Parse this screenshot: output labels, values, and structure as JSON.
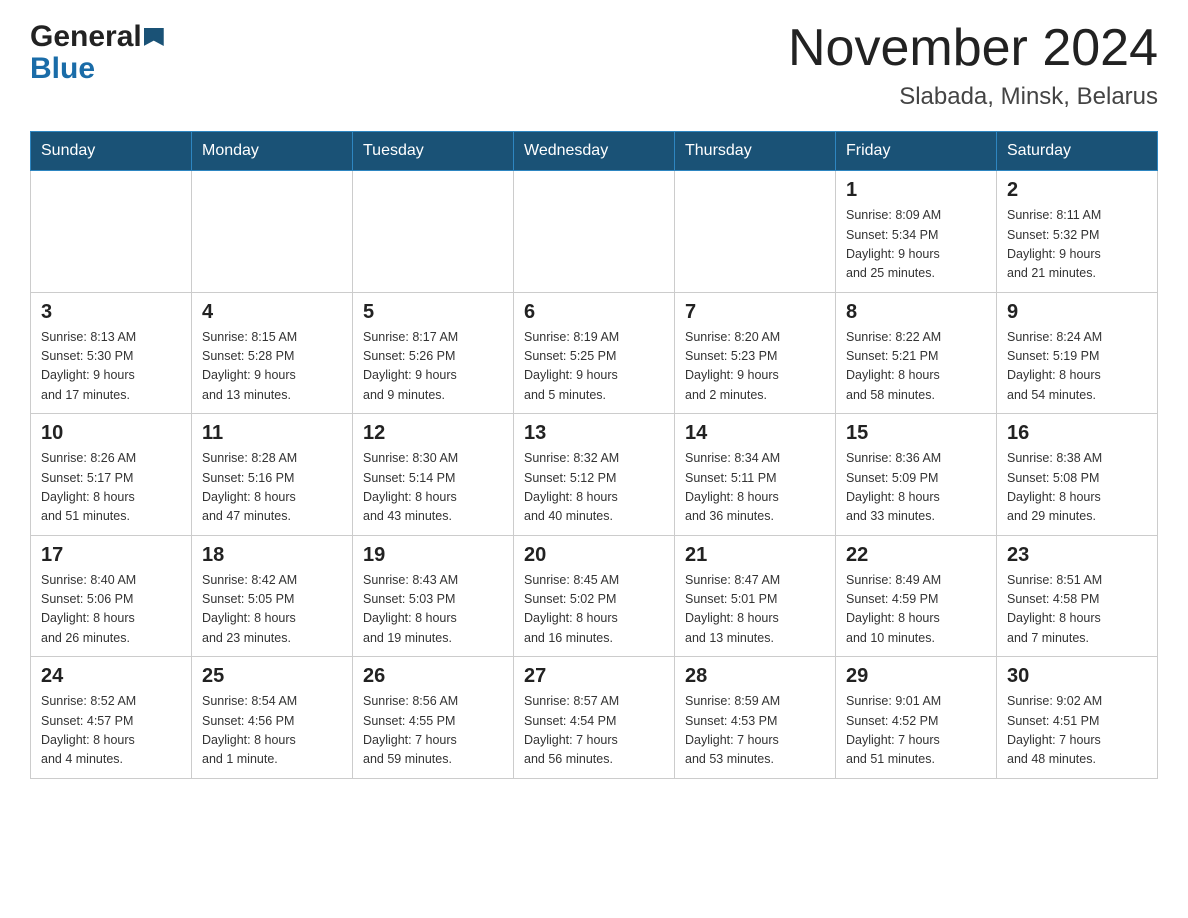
{
  "header": {
    "logo_general": "General",
    "logo_blue": "Blue",
    "month_title": "November 2024",
    "location": "Slabada, Minsk, Belarus"
  },
  "weekdays": [
    "Sunday",
    "Monday",
    "Tuesday",
    "Wednesday",
    "Thursday",
    "Friday",
    "Saturday"
  ],
  "weeks": [
    [
      {
        "day": "",
        "info": ""
      },
      {
        "day": "",
        "info": ""
      },
      {
        "day": "",
        "info": ""
      },
      {
        "day": "",
        "info": ""
      },
      {
        "day": "",
        "info": ""
      },
      {
        "day": "1",
        "info": "Sunrise: 8:09 AM\nSunset: 5:34 PM\nDaylight: 9 hours\nand 25 minutes."
      },
      {
        "day": "2",
        "info": "Sunrise: 8:11 AM\nSunset: 5:32 PM\nDaylight: 9 hours\nand 21 minutes."
      }
    ],
    [
      {
        "day": "3",
        "info": "Sunrise: 8:13 AM\nSunset: 5:30 PM\nDaylight: 9 hours\nand 17 minutes."
      },
      {
        "day": "4",
        "info": "Sunrise: 8:15 AM\nSunset: 5:28 PM\nDaylight: 9 hours\nand 13 minutes."
      },
      {
        "day": "5",
        "info": "Sunrise: 8:17 AM\nSunset: 5:26 PM\nDaylight: 9 hours\nand 9 minutes."
      },
      {
        "day": "6",
        "info": "Sunrise: 8:19 AM\nSunset: 5:25 PM\nDaylight: 9 hours\nand 5 minutes."
      },
      {
        "day": "7",
        "info": "Sunrise: 8:20 AM\nSunset: 5:23 PM\nDaylight: 9 hours\nand 2 minutes."
      },
      {
        "day": "8",
        "info": "Sunrise: 8:22 AM\nSunset: 5:21 PM\nDaylight: 8 hours\nand 58 minutes."
      },
      {
        "day": "9",
        "info": "Sunrise: 8:24 AM\nSunset: 5:19 PM\nDaylight: 8 hours\nand 54 minutes."
      }
    ],
    [
      {
        "day": "10",
        "info": "Sunrise: 8:26 AM\nSunset: 5:17 PM\nDaylight: 8 hours\nand 51 minutes."
      },
      {
        "day": "11",
        "info": "Sunrise: 8:28 AM\nSunset: 5:16 PM\nDaylight: 8 hours\nand 47 minutes."
      },
      {
        "day": "12",
        "info": "Sunrise: 8:30 AM\nSunset: 5:14 PM\nDaylight: 8 hours\nand 43 minutes."
      },
      {
        "day": "13",
        "info": "Sunrise: 8:32 AM\nSunset: 5:12 PM\nDaylight: 8 hours\nand 40 minutes."
      },
      {
        "day": "14",
        "info": "Sunrise: 8:34 AM\nSunset: 5:11 PM\nDaylight: 8 hours\nand 36 minutes."
      },
      {
        "day": "15",
        "info": "Sunrise: 8:36 AM\nSunset: 5:09 PM\nDaylight: 8 hours\nand 33 minutes."
      },
      {
        "day": "16",
        "info": "Sunrise: 8:38 AM\nSunset: 5:08 PM\nDaylight: 8 hours\nand 29 minutes."
      }
    ],
    [
      {
        "day": "17",
        "info": "Sunrise: 8:40 AM\nSunset: 5:06 PM\nDaylight: 8 hours\nand 26 minutes."
      },
      {
        "day": "18",
        "info": "Sunrise: 8:42 AM\nSunset: 5:05 PM\nDaylight: 8 hours\nand 23 minutes."
      },
      {
        "day": "19",
        "info": "Sunrise: 8:43 AM\nSunset: 5:03 PM\nDaylight: 8 hours\nand 19 minutes."
      },
      {
        "day": "20",
        "info": "Sunrise: 8:45 AM\nSunset: 5:02 PM\nDaylight: 8 hours\nand 16 minutes."
      },
      {
        "day": "21",
        "info": "Sunrise: 8:47 AM\nSunset: 5:01 PM\nDaylight: 8 hours\nand 13 minutes."
      },
      {
        "day": "22",
        "info": "Sunrise: 8:49 AM\nSunset: 4:59 PM\nDaylight: 8 hours\nand 10 minutes."
      },
      {
        "day": "23",
        "info": "Sunrise: 8:51 AM\nSunset: 4:58 PM\nDaylight: 8 hours\nand 7 minutes."
      }
    ],
    [
      {
        "day": "24",
        "info": "Sunrise: 8:52 AM\nSunset: 4:57 PM\nDaylight: 8 hours\nand 4 minutes."
      },
      {
        "day": "25",
        "info": "Sunrise: 8:54 AM\nSunset: 4:56 PM\nDaylight: 8 hours\nand 1 minute."
      },
      {
        "day": "26",
        "info": "Sunrise: 8:56 AM\nSunset: 4:55 PM\nDaylight: 7 hours\nand 59 minutes."
      },
      {
        "day": "27",
        "info": "Sunrise: 8:57 AM\nSunset: 4:54 PM\nDaylight: 7 hours\nand 56 minutes."
      },
      {
        "day": "28",
        "info": "Sunrise: 8:59 AM\nSunset: 4:53 PM\nDaylight: 7 hours\nand 53 minutes."
      },
      {
        "day": "29",
        "info": "Sunrise: 9:01 AM\nSunset: 4:52 PM\nDaylight: 7 hours\nand 51 minutes."
      },
      {
        "day": "30",
        "info": "Sunrise: 9:02 AM\nSunset: 4:51 PM\nDaylight: 7 hours\nand 48 minutes."
      }
    ]
  ]
}
